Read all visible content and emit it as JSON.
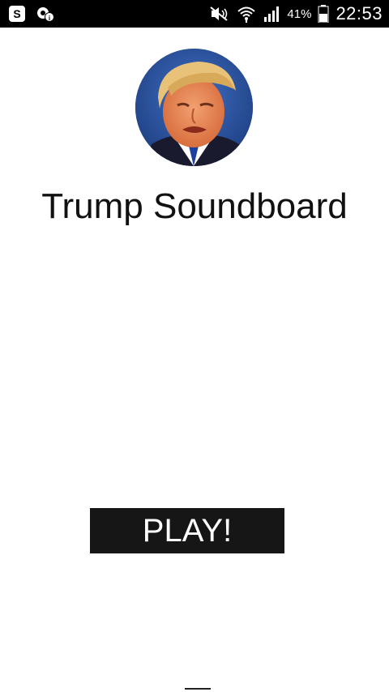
{
  "status_bar": {
    "left_icons": [
      "skype-icon",
      "app-settings-icon"
    ],
    "right_icons": [
      "mute-icon",
      "wifi-icon",
      "signal-icon",
      "battery-icon"
    ],
    "battery_percent": "41%",
    "time": "22:53"
  },
  "header": {
    "avatar_icon": "avatar-portrait",
    "title": "Trump Soundboard"
  },
  "main": {
    "play_label": "PLAY!"
  },
  "colors": {
    "status_bar_bg": "#000000",
    "background": "#ffffff",
    "button_bg": "#161616",
    "button_text": "#ffffff",
    "avatar_bg": "#2a4f8f"
  }
}
